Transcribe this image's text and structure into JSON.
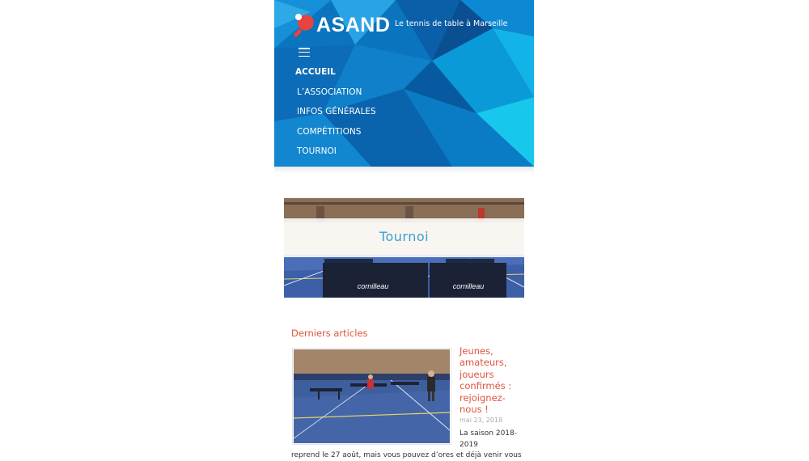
{
  "site": {
    "logo_text": "ASAND",
    "tagline": "Le tennis de table à Marseille",
    "colors": {
      "header_blue": "#0a6fb8",
      "accent_red": "#e0533e",
      "banner_text": "#3b9fd4"
    }
  },
  "menu": {
    "toggle_icon": "hamburger-menu-icon",
    "items": [
      {
        "label": "ACCUEIL",
        "active": true
      },
      {
        "label": "L’ASSOCIATION"
      },
      {
        "label": "INFOS GÉNÉRALES"
      },
      {
        "label": "COMPÉTITIONS"
      },
      {
        "label": "TOURNOI"
      }
    ]
  },
  "banner": {
    "title": "Tournoi"
  },
  "latest": {
    "heading": "Derniers articles",
    "articles": [
      {
        "title": "Jeunes, amateurs, joueurs confirmés : rejoignez-nous !",
        "date": "mai 23, 2018",
        "excerpt_a": "La saison 2018-2019",
        "excerpt_b": "reprend le 27 août, mais vous pouvez d’ores et déjà venir vous"
      }
    ]
  }
}
